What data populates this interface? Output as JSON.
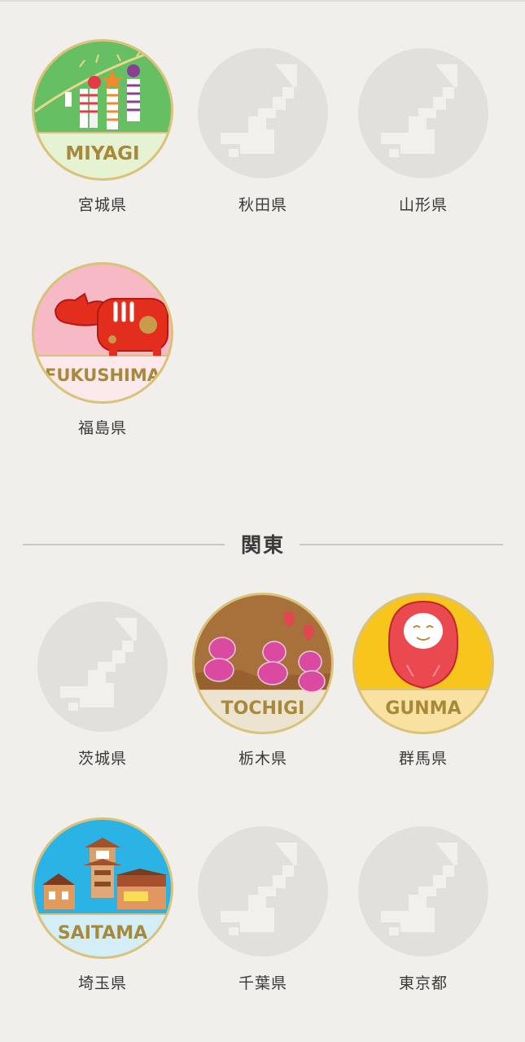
{
  "tohoku": {
    "prefectures": [
      {
        "name": "宮城県",
        "unlocked": true,
        "badge_label": "MIYAGI"
      },
      {
        "name": "秋田県",
        "unlocked": false
      },
      {
        "name": "山形県",
        "unlocked": false
      },
      {
        "name": "福島県",
        "unlocked": true,
        "badge_label": "FUKUSHIMA"
      }
    ]
  },
  "kanto": {
    "title": "関東",
    "prefectures": [
      {
        "name": "茨城県",
        "unlocked": false
      },
      {
        "name": "栃木県",
        "unlocked": true,
        "badge_label": "TOCHIGI"
      },
      {
        "name": "群馬県",
        "unlocked": true,
        "badge_label": "GUNMA"
      },
      {
        "name": "埼玉県",
        "unlocked": true,
        "badge_label": "SAITAMA"
      },
      {
        "name": "千葉県",
        "unlocked": false
      },
      {
        "name": "東京都",
        "unlocked": false
      }
    ]
  },
  "colors": {
    "background": "#f1efeb",
    "locked_badge": "#e1e0dc",
    "locked_icon": "#f1f0ec",
    "gold_rim": "#d9c27a",
    "label_gold": "#a8893a"
  }
}
